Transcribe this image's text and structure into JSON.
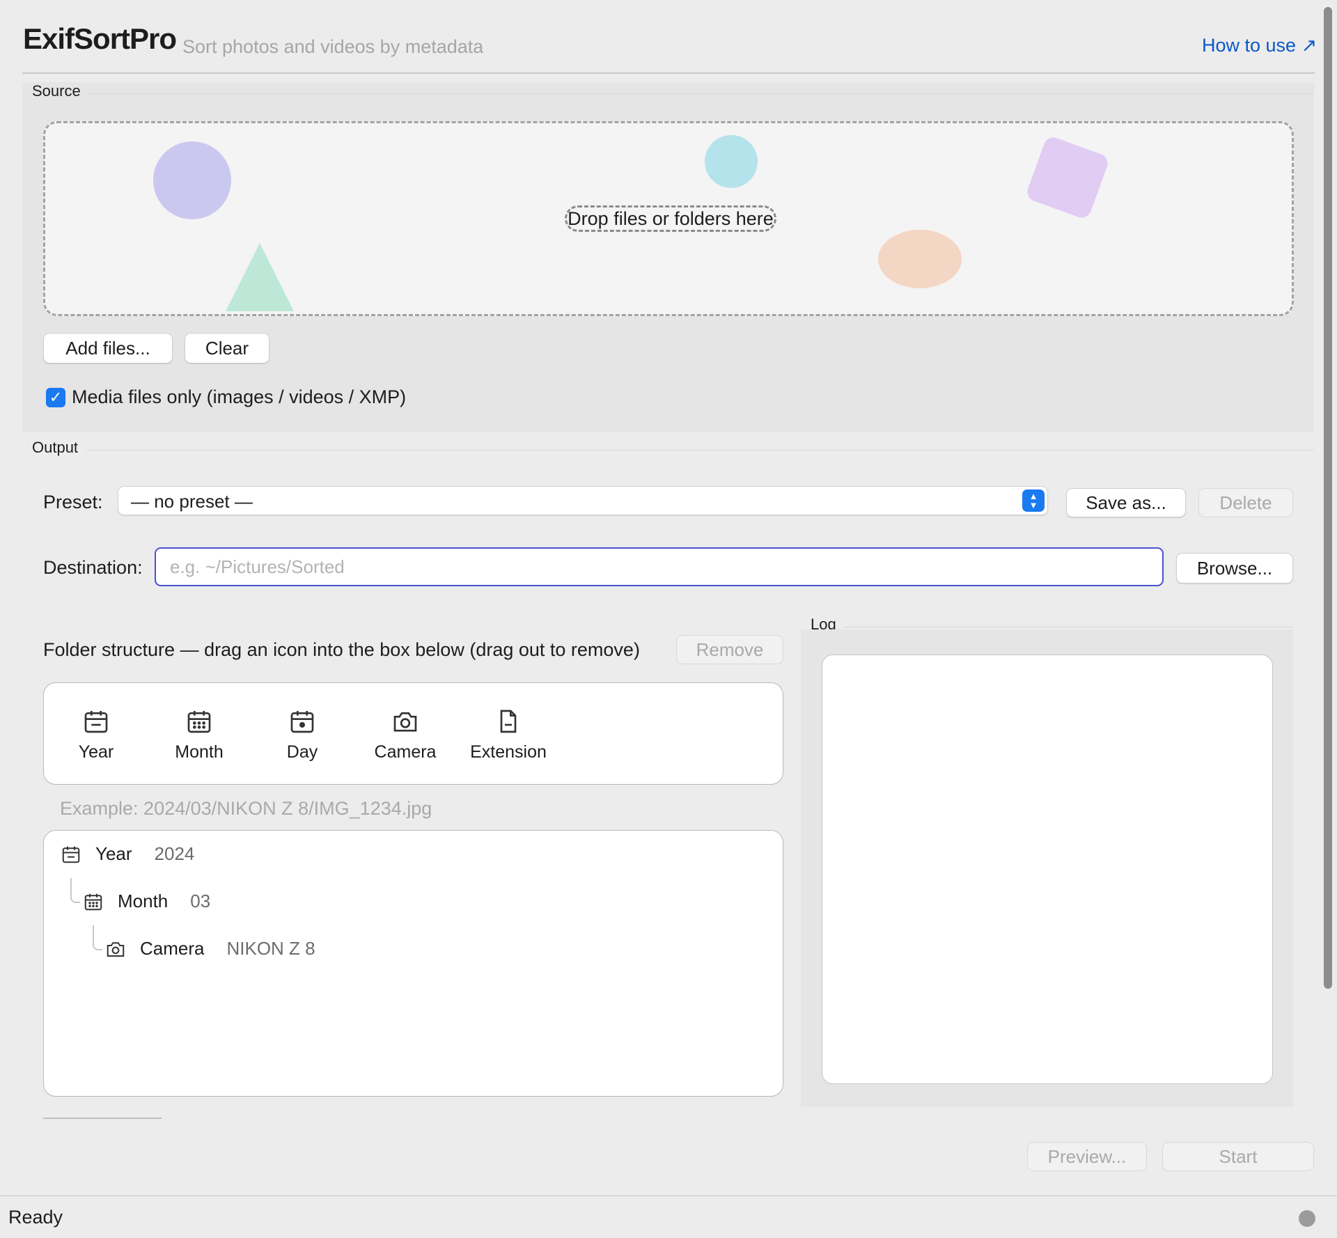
{
  "header": {
    "title": "ExifSortPro",
    "subtitle": "Sort photos and videos by metadata",
    "help_link": "How to use ↗"
  },
  "source": {
    "label": "Source",
    "drop_text": "Drop files or folders here",
    "add_files_label": "Add files...",
    "clear_label": "Clear",
    "media_only_label": "Media files only (images / videos / XMP)",
    "media_only_checked": true
  },
  "output": {
    "label": "Output",
    "preset_label": "Preset:",
    "preset_value": "— no preset —",
    "save_as_label": "Save as...",
    "delete_label": "Delete",
    "destination_label": "Destination:",
    "destination_value": "",
    "destination_placeholder": "e.g. ~/Pictures/Sorted",
    "browse_label": "Browse..."
  },
  "folder_structure": {
    "instructions": "Folder structure — drag an icon into the box below (drag out to remove)",
    "remove_label": "Remove",
    "palette": [
      {
        "label": "Year",
        "icon": "calendar-icon"
      },
      {
        "label": "Month",
        "icon": "calendar-grid-icon"
      },
      {
        "label": "Day",
        "icon": "calendar-day-icon"
      },
      {
        "label": "Camera",
        "icon": "camera-icon"
      },
      {
        "label": "Extension",
        "icon": "file-icon"
      }
    ],
    "example": "Example: 2024/03/NIKON Z 8/IMG_1234.jpg",
    "tree": [
      {
        "key": "Year",
        "value": "2024",
        "icon": "calendar-icon"
      },
      {
        "key": "Month",
        "value": "03",
        "icon": "calendar-grid-icon"
      },
      {
        "key": "Camera",
        "value": "NIKON Z 8",
        "icon": "camera-icon"
      }
    ]
  },
  "log": {
    "label": "Log",
    "content": ""
  },
  "actions": {
    "preview_label": "Preview...",
    "start_label": "Start"
  },
  "status": {
    "text": "Ready"
  },
  "colors": {
    "accent": "#1a7af0",
    "link": "#0a58c9",
    "focus_border": "#4a4fd1"
  }
}
